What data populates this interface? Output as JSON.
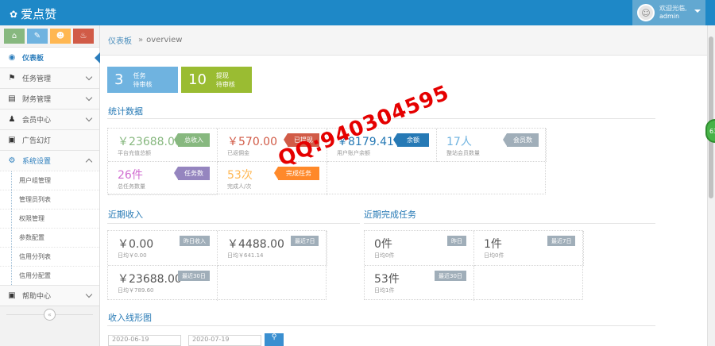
{
  "navbar": {
    "brand": "爱点赞",
    "user_greeting": "欢迎光临,",
    "user_name": "admin"
  },
  "sidebar": {
    "shortcuts": [
      {
        "name": "home",
        "color": "#87b87f"
      },
      {
        "name": "pencil",
        "color": "#6fb3e0"
      },
      {
        "name": "users",
        "color": "#ffb752"
      },
      {
        "name": "bell",
        "color": "#d15b47"
      }
    ],
    "items": [
      {
        "label": "仪表板"
      },
      {
        "label": "任务管理"
      },
      {
        "label": "财务管理"
      },
      {
        "label": "会员中心"
      },
      {
        "label": "广告幻灯"
      },
      {
        "label": "系统设置"
      },
      {
        "label": "帮助中心"
      }
    ],
    "sub_items": [
      "用户组管理",
      "管理员列表",
      "权限管理",
      "参数配置",
      "信用分列表",
      "信用分配置"
    ]
  },
  "breadcrumb": {
    "home": "仪表板",
    "separator": "»",
    "current": "overview"
  },
  "float_badge": "63",
  "tiles": [
    {
      "number": "3",
      "line1": "任务",
      "line2": "待审核",
      "color": "#6fb3e0"
    },
    {
      "number": "10",
      "line1": "提现",
      "line2": "待审核",
      "color": "#9abc32"
    }
  ],
  "stats": {
    "title": "统计数据",
    "cells": [
      {
        "value": "￥23688.00",
        "desc": "平台充值总额",
        "tag": "总收入",
        "value_color": "#87b87f",
        "tag_color": "#87b87f"
      },
      {
        "value": "￥570.00",
        "desc": "已返佣金",
        "tag": "已提现",
        "value_color": "#d15b47",
        "tag_color": "#d15b47"
      },
      {
        "value": "￥8179.41",
        "desc": "用户账户余额",
        "tag": "余额",
        "value_color": "#2679b5",
        "tag_color": "#2679b5"
      },
      {
        "value": "17人",
        "desc": "整站会员数量",
        "tag": "会员数",
        "value_color": "#6fb3e0",
        "tag_color": "#a0aeb9"
      },
      {
        "value": "26件",
        "desc": "总任务数量",
        "tag": "任务数",
        "value_color": "#d06bd0",
        "tag_color": "#9585bf"
      },
      {
        "value": "53次",
        "desc": "完成人/次",
        "tag": "完成任务",
        "value_color": "#ffb752",
        "tag_color": "#ff892a"
      }
    ]
  },
  "income": {
    "title": "近期收入",
    "cells": [
      {
        "value": "￥0.00",
        "desc": "日均￥0.00",
        "tag": "昨日收入"
      },
      {
        "value": "￥4488.00",
        "desc": "日均￥641.14",
        "tag": "最近7日"
      },
      {
        "value": "￥23688.00",
        "desc": "日均￥789.60",
        "tag": "最近30日"
      }
    ]
  },
  "tasks": {
    "title": "近期完成任务",
    "cells": [
      {
        "value": "0件",
        "desc": "日均0件",
        "tag": "昨日"
      },
      {
        "value": "1件",
        "desc": "日均0件",
        "tag": "最近7日"
      },
      {
        "value": "53件",
        "desc": "日均1件",
        "tag": "最近30日"
      }
    ]
  },
  "chart_section": {
    "title": "收入线形图",
    "start_date": "2020-06-19",
    "end_date": "2020-07-19"
  },
  "watermark": "QQ:940304595"
}
